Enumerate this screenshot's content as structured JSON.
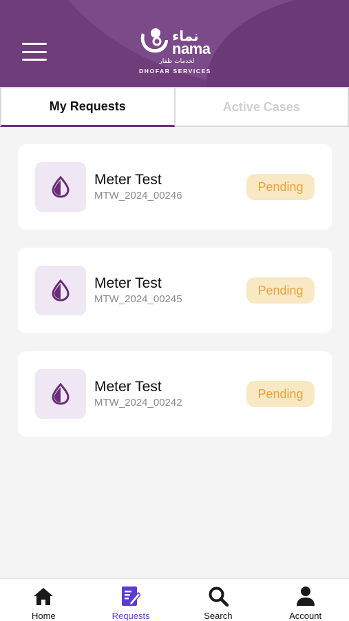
{
  "header": {
    "logo_arabic": "نماء",
    "logo_latin": "nama",
    "logo_arabic_sub": "لخدمات ظفار",
    "logo_sub": "DHOFAR SERVICES"
  },
  "tabs": [
    {
      "label": "My Requests",
      "active": true
    },
    {
      "label": "Active Cases",
      "active": false
    }
  ],
  "requests": [
    {
      "title": "Meter Test",
      "code": "MTW_2024_00246",
      "status": "Pending",
      "icon": "water-drop-icon"
    },
    {
      "title": "Meter Test",
      "code": "MTW_2024_00245",
      "status": "Pending",
      "icon": "water-drop-icon"
    },
    {
      "title": "Meter Test",
      "code": "MTW_2024_00242",
      "status": "Pending",
      "icon": "water-drop-icon"
    }
  ],
  "bottom_nav": [
    {
      "label": "Home",
      "icon": "home-icon",
      "active": false
    },
    {
      "label": "Requests",
      "icon": "requests-icon",
      "active": true
    },
    {
      "label": "Search",
      "icon": "search-icon",
      "active": false
    },
    {
      "label": "Account",
      "icon": "account-icon",
      "active": false
    }
  ],
  "colors": {
    "brand": "#6e3d7a",
    "tab_underline": "#6e2c7c",
    "pending_bg": "#f8e8c4",
    "pending_text": "#e8a23e",
    "nav_active": "#5b3bd0"
  }
}
